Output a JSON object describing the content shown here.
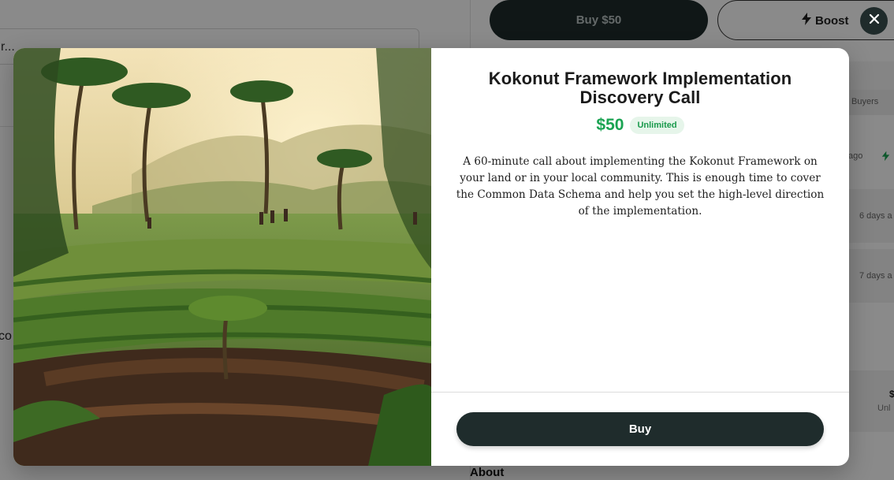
{
  "background": {
    "left_field_text": "r...",
    "partial_text": "co",
    "header_buy_label": "Buy $50",
    "header_boost_label": "Boost",
    "buyers_label": "Buyers",
    "row1_time": "ago",
    "row2_time": "6 days a",
    "row3_time": "7 days a",
    "side_price": "$",
    "side_unlimited": "Unl",
    "about_heading": "About"
  },
  "modal": {
    "title": "Kokonut Framework Implementation Discovery Call",
    "price": "$50",
    "availability_badge": "Unlimited",
    "description": "A 60-minute call about implementing the Kokonut Framework on your land or in your local community. This is enough time to cover the Common Data Schema and help you set the high-level direction of the implementation.",
    "buy_label": "Buy",
    "image_subject": "tropical farmland with palm trees and people walking through terraced crops at sunrise"
  },
  "icons": {
    "close": "close-icon",
    "boost": "lightning-bolt-icon"
  },
  "colors": {
    "primary_dark": "#1f2c2c",
    "price_green": "#1aa352",
    "badge_bg": "#e6f5ea"
  }
}
